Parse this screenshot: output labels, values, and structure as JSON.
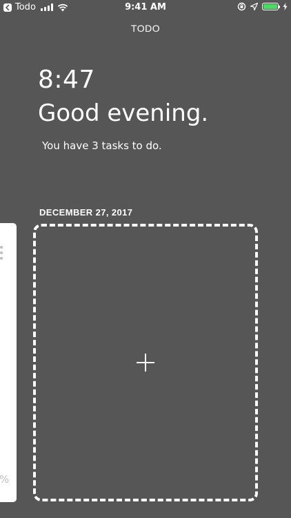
{
  "status_bar": {
    "back_app": "Todo",
    "time": "9:41 AM",
    "signal_icon": "signal-bars-icon",
    "wifi_icon": "wifi-icon",
    "lock_icon": "orientation-lock-icon",
    "location_icon": "location-arrow-icon",
    "charging_icon": "charging-bolt-icon",
    "battery_level": 1.0,
    "battery_color": "#4cd964"
  },
  "header": {
    "title": "TODO"
  },
  "hero": {
    "clock": "8:47",
    "greeting": "Good evening.",
    "subtitle": "You have 3 tasks to do."
  },
  "date": {
    "label": "DECEMBER 27, 2017"
  },
  "cards": {
    "previous_card_partial_text": "%",
    "add_card_icon": "plus-icon"
  },
  "colors": {
    "background": "#565656",
    "text": "#ffffff",
    "card": "#ffffff"
  }
}
